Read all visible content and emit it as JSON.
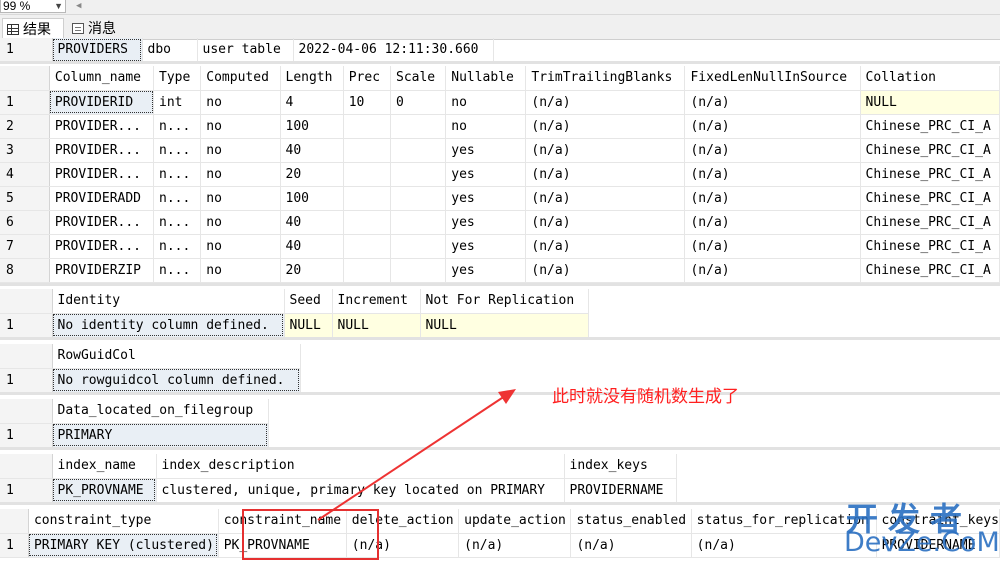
{
  "toolbar": {
    "zoom": "99 %"
  },
  "tabs": [
    {
      "label": "结果"
    },
    {
      "label": "消息"
    }
  ],
  "grid1": {
    "row": [
      "1",
      "PROVIDERS",
      "dbo",
      "user table",
      "2022-04-06 12:11:30.660"
    ]
  },
  "grid2": {
    "headers": [
      "Column_name",
      "Type",
      "Computed",
      "Length",
      "Prec",
      "Scale",
      "Nullable",
      "TrimTrailingBlanks",
      "FixedLenNullInSource",
      "Collation"
    ],
    "rows": [
      [
        "1",
        "PROVIDERID",
        "int",
        "no",
        "4",
        "10",
        "0",
        "no",
        "(n/a)",
        "(n/a)",
        "NULL"
      ],
      [
        "2",
        "PROVIDER...",
        "n...",
        "no",
        "100",
        "",
        "",
        "no",
        "(n/a)",
        "(n/a)",
        "Chinese_PRC_CI_A"
      ],
      [
        "3",
        "PROVIDER...",
        "n...",
        "no",
        "40",
        "",
        "",
        "yes",
        "(n/a)",
        "(n/a)",
        "Chinese_PRC_CI_A"
      ],
      [
        "4",
        "PROVIDER...",
        "n...",
        "no",
        "20",
        "",
        "",
        "yes",
        "(n/a)",
        "(n/a)",
        "Chinese_PRC_CI_A"
      ],
      [
        "5",
        "PROVIDERADD",
        "n...",
        "no",
        "100",
        "",
        "",
        "yes",
        "(n/a)",
        "(n/a)",
        "Chinese_PRC_CI_A"
      ],
      [
        "6",
        "PROVIDER...",
        "n...",
        "no",
        "40",
        "",
        "",
        "yes",
        "(n/a)",
        "(n/a)",
        "Chinese_PRC_CI_A"
      ],
      [
        "7",
        "PROVIDER...",
        "n...",
        "no",
        "40",
        "",
        "",
        "yes",
        "(n/a)",
        "(n/a)",
        "Chinese_PRC_CI_A"
      ],
      [
        "8",
        "PROVIDERZIP",
        "n...",
        "no",
        "20",
        "",
        "",
        "yes",
        "(n/a)",
        "(n/a)",
        "Chinese_PRC_CI_A"
      ]
    ]
  },
  "grid3": {
    "headers": [
      "Identity",
      "Seed",
      "Increment",
      "Not For Replication"
    ],
    "row": [
      "1",
      "No identity column defined.",
      "NULL",
      "NULL",
      "NULL"
    ]
  },
  "grid4": {
    "headers": [
      "RowGuidCol"
    ],
    "row": [
      "1",
      "No rowguidcol column defined."
    ]
  },
  "grid5": {
    "headers": [
      "Data_located_on_filegroup"
    ],
    "row": [
      "1",
      "PRIMARY"
    ]
  },
  "grid6": {
    "headers": [
      "index_name",
      "index_description",
      "index_keys"
    ],
    "row": [
      "1",
      "PK_PROVNAME",
      "clustered, unique, primary key located on PRIMARY",
      "PROVIDERNAME"
    ]
  },
  "grid7": {
    "headers": [
      "constraint_type",
      "constraint_name",
      "delete_action",
      "update_action",
      "status_enabled",
      "status_for_replication",
      "constraint_keys"
    ],
    "row": [
      "1",
      "PRIMARY KEY (clustered)",
      "PK_PROVNAME",
      "(n/a)",
      "(n/a)",
      "(n/a)",
      "(n/a)",
      "PROVIDERNAME"
    ]
  },
  "annotation": {
    "text": "此时就没有随机数生成了",
    "color": "#ff2020"
  },
  "watermark": {
    "cn": "开发者",
    "en": "DevZe.CoM",
    "color": "#2a6fc1"
  }
}
